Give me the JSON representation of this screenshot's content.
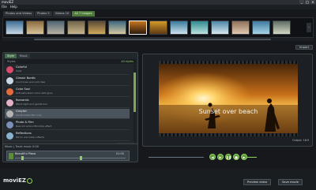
{
  "window": {
    "title": "moviEZ",
    "controls": [
      "_",
      "□",
      "×"
    ]
  },
  "menu": [
    "File",
    "Help"
  ],
  "tabs": [
    {
      "label": "Photos and Videos",
      "active": false
    },
    {
      "label": "Photos 5",
      "active": false
    },
    {
      "label": "Videos 10",
      "active": false
    },
    {
      "label": "All 7 Images",
      "active": true
    }
  ],
  "filmstrip": {
    "thumbs": [
      {
        "name": "thumb-1",
        "c1": "#3d6e96",
        "c2": "#c9d8e4"
      },
      {
        "name": "thumb-2",
        "c1": "#8a6a3e",
        "c2": "#d8c39a"
      },
      {
        "name": "thumb-3",
        "c1": "#506574",
        "c2": "#b8b0a4"
      },
      {
        "name": "thumb-4",
        "c1": "#726547",
        "c2": "#c6b48d"
      },
      {
        "name": "thumb-5",
        "c1": "#5a4a36",
        "c2": "#d0aa5c"
      },
      {
        "name": "thumb-6",
        "c1": "#3c6880",
        "c2": "#d6c8a2"
      },
      {
        "name": "thumb-7",
        "c1": "#c7761e",
        "c2": "#2a1a0c",
        "selected": true
      },
      {
        "name": "thumb-8",
        "c1": "#d39a28",
        "c2": "#5e3a14"
      },
      {
        "name": "thumb-9",
        "c1": "#3a7a9c",
        "c2": "#cfe3ee"
      },
      {
        "name": "thumb-10",
        "c1": "#2f8a8e",
        "c2": "#bce2e0"
      },
      {
        "name": "thumb-11",
        "c1": "#4d87a8",
        "c2": "#d8e8ef"
      },
      {
        "name": "thumb-12",
        "c1": "#8e7058",
        "c2": "#e0c8b0"
      },
      {
        "name": "thumb-13",
        "c1": "#3f7aa0",
        "c2": "#a8d4e6"
      },
      {
        "name": "thumb-14",
        "c1": "#5e6e62",
        "c2": "#d2d6c4"
      }
    ]
  },
  "import_button": "Import",
  "left_panel": {
    "tabs": [
      {
        "label": "Style",
        "active": true
      },
      {
        "label": "Music",
        "active": false
      }
    ],
    "header": "Styles",
    "header_right": "All styles",
    "styles": [
      {
        "name": "Colorful",
        "desc": "Vivid",
        "color": "#d94b6a"
      },
      {
        "name": "Classic Nordic",
        "desc": "Cool tones and calm feel",
        "color": "#c9d6e3"
      },
      {
        "name": "Color Soul",
        "desc": "Soft saturated colors with glow",
        "color": "#e26a3c"
      },
      {
        "name": "Romantic",
        "desc": "Warm light and gentle blur",
        "color": "#e3b0c6"
      },
      {
        "name": "Grayish",
        "desc": "Desaturated film look",
        "color": "#b3b3b3",
        "selected": true
      },
      {
        "name": "Photo & Film",
        "desc": "Real old school filmstrip effect",
        "color": "#7c8fb6"
      },
      {
        "name": "Reflections",
        "desc": "Mirror and water effects",
        "color": "#8ab2cc"
      }
    ],
    "footer": "Show more"
  },
  "music": {
    "header": "Music  |  Track music  0:00",
    "track_name": "Beautiful Piano",
    "track_num": "01:00"
  },
  "preview": {
    "caption": "Sunset over beach",
    "output_label": "Output: 16:9"
  },
  "controls": {
    "prev": "◀",
    "play": "▶",
    "pause": "❚❚",
    "stop": "■",
    "next": "▶"
  },
  "bottom": {
    "logo": "moviEZ",
    "preview_button": "Preview video",
    "save_button": "Save movie"
  }
}
